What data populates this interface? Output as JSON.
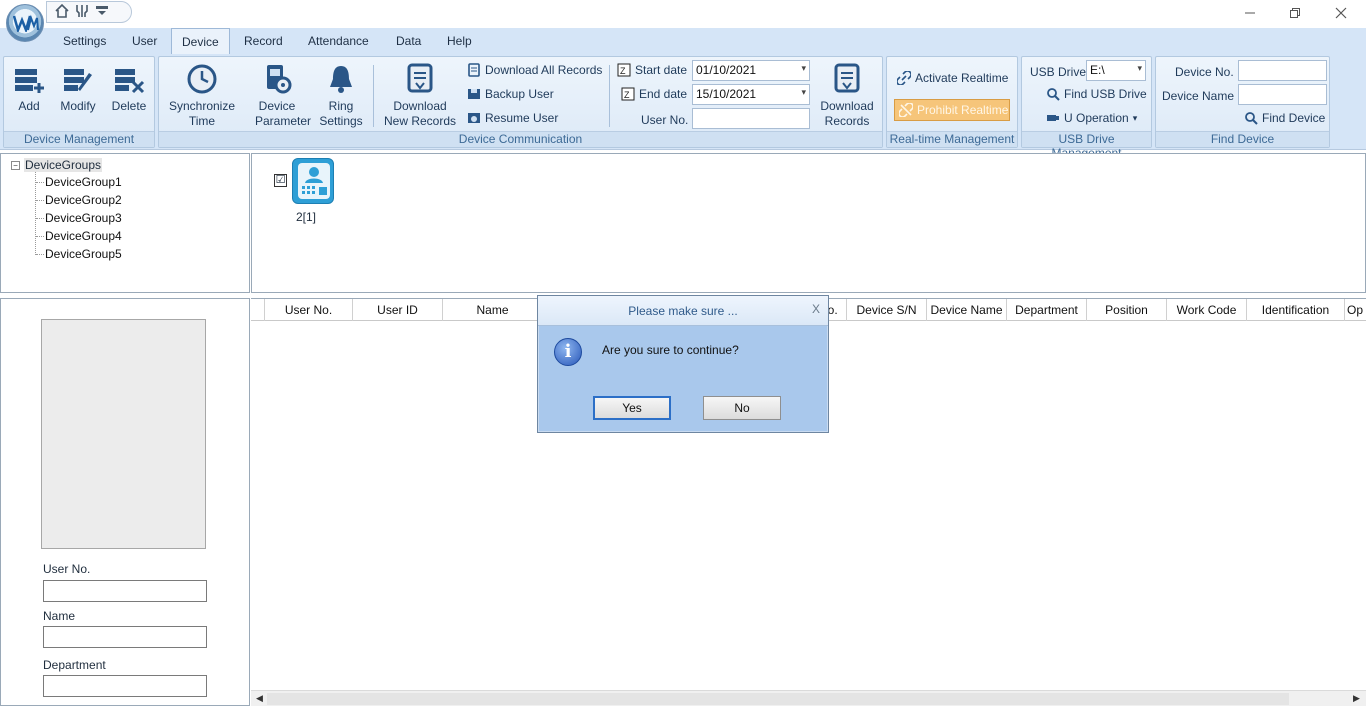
{
  "menu_tabs": [
    "Settings",
    "User",
    "Device",
    "Record",
    "Attendance",
    "Data",
    "Help"
  ],
  "active_tab": "Device",
  "device_management": {
    "label": "Device Management",
    "add": "Add",
    "modify": "Modify",
    "delete": "Delete"
  },
  "device_communication": {
    "label": "Device Communication",
    "sync_line1": "Synchronize",
    "sync_line2": "Time",
    "param_line1": "Device",
    "param_line2": "Parameter",
    "ring_line1": "Ring",
    "ring_line2": "Settings",
    "dl_new_line1": "Download",
    "dl_new_line2": "New Records",
    "download_all": "Download All Records",
    "backup_user": "Backup User",
    "resume_user": "Resume User",
    "start_date_label": "Start date",
    "start_date": "01/10/2021",
    "end_date_label": "End date",
    "end_date": "15/10/2021",
    "user_no_label": "User No.",
    "dl_rec_line1": "Download",
    "dl_rec_line2": "Records"
  },
  "realtime": {
    "label": "Real-time Management",
    "activate": "Activate Realtime",
    "prohibit": "Prohibit Realtime"
  },
  "usb": {
    "label": "USB Drive Management",
    "drive_label": "USB Drive",
    "drive_value": "E:\\",
    "find": "Find USB Drive",
    "operation": "U Operation"
  },
  "find_device": {
    "label": "Find Device",
    "device_no_label": "Device No.",
    "device_name_label": "Device Name",
    "button": "Find Device"
  },
  "tree": {
    "root": "DeviceGroups",
    "groups": [
      "DeviceGroup1",
      "DeviceGroup2",
      "DeviceGroup3",
      "DeviceGroup4",
      "DeviceGroup5"
    ]
  },
  "device_tile": {
    "label": "2[1]",
    "checked": "☑"
  },
  "user_info": {
    "user_no_label": "User No.",
    "name_label": "Name",
    "department_label": "Department"
  },
  "grid_columns": [
    "User No.",
    "User ID",
    "Name",
    "",
    "No.",
    "Device S/N",
    "Device Name",
    "Department",
    "Position",
    "Work Code",
    "Identification",
    "Op"
  ],
  "dialog": {
    "title": "Please make sure ...",
    "close": "X",
    "message": "Are you sure to continue?",
    "yes": "Yes",
    "no": "No"
  },
  "colors": {
    "ribbon_bg": "#d5e5f7",
    "accent": "#2e9fd6",
    "prohibit_bg": "#f6c57a",
    "dialog_bg": "#a9c8ec"
  }
}
